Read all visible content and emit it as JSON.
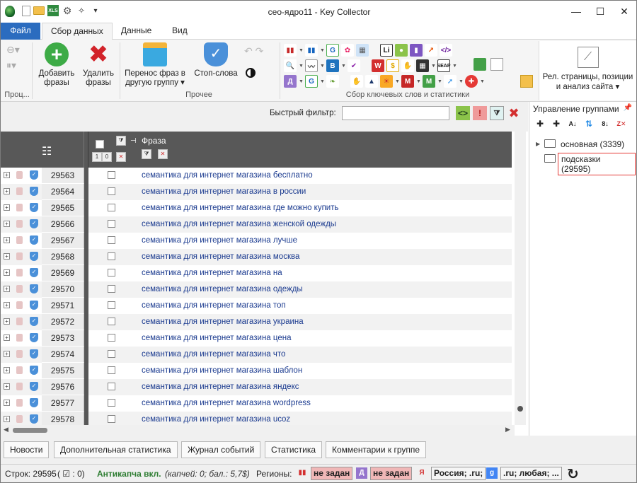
{
  "window": {
    "title": "сео-ядро11 - Key Collector",
    "minimize": "—",
    "maximize": "☐",
    "close": "✕"
  },
  "ribbon_tabs": [
    "Файл",
    "Сбор данных",
    "Данные",
    "Вид"
  ],
  "ribbon": {
    "process_group_label": "Проц...",
    "add_phrases": "Добавить фразы",
    "add_phrases_l1": "Добавить",
    "add_phrases_l2": "фразы",
    "delete_phrases_l1": "Удалить",
    "delete_phrases_l2": "фразы",
    "move_phrases_l1": "Перенос фраз в",
    "move_phrases_l2": "другую группу ▾",
    "stop_words": "Стоп-слова",
    "other_group_label": "Прочее",
    "collect_group_label": "Сбор ключевых слов и статистики",
    "rel_pages_l1": "Рел. страницы, позиции",
    "rel_pages_l2": "и анализ сайта ▾"
  },
  "filter": {
    "label": "Быстрый фильтр:",
    "value": ""
  },
  "grid": {
    "column_phrase": "Фраза",
    "rows": [
      {
        "id": "29563",
        "phrase": "семантика для интернет магазина бесплатно"
      },
      {
        "id": "29564",
        "phrase": "семантика для интернет магазина в россии"
      },
      {
        "id": "29565",
        "phrase": "семантика для интернет магазина где можно купить"
      },
      {
        "id": "29566",
        "phrase": "семантика для интернет магазина женской одежды"
      },
      {
        "id": "29567",
        "phrase": "семантика для интернет магазина лучше"
      },
      {
        "id": "29568",
        "phrase": "семантика для интернет магазина москва"
      },
      {
        "id": "29569",
        "phrase": "семантика для интернет магазина на"
      },
      {
        "id": "29570",
        "phrase": "семантика для интернет магазина одежды"
      },
      {
        "id": "29571",
        "phrase": "семантика для интернет магазина топ"
      },
      {
        "id": "29572",
        "phrase": "семантика для интернет магазина украина"
      },
      {
        "id": "29573",
        "phrase": "семантика для интернет магазина цена"
      },
      {
        "id": "29574",
        "phrase": "семантика для интернет магазина что"
      },
      {
        "id": "29575",
        "phrase": "семантика для интернет магазина шаблон"
      },
      {
        "id": "29576",
        "phrase": "семантика для интернет магазина яндекс"
      },
      {
        "id": "29577",
        "phrase": "семантика для интернет магазина wordpress"
      },
      {
        "id": "29578",
        "phrase": "семантика для интернет магазина ucoz"
      }
    ]
  },
  "group_panel": {
    "title": "Управление группами",
    "groups": [
      {
        "label": "основная (3339)"
      },
      {
        "label": "подсказки (29595)"
      }
    ]
  },
  "bottom_tabs": [
    "Новости",
    "Дополнительная статистика",
    "Журнал событий",
    "Статистика",
    "Комментарии к группе"
  ],
  "status": {
    "rows_label": "Строк: 29595",
    "checked_label": "( ☑ : 0)",
    "anticaptcha": "Антикапча вкл.",
    "anticaptcha_info": "(капчей: 0; бал.: 5,7$)",
    "regions_label": "Регионы:",
    "region1": "не задан",
    "region2": "не задан",
    "region3": "Россия; .ru;",
    "region4": ".ru; любая; ..."
  },
  "colors": {
    "accent": "#2b6cbf",
    "grid_header": "#585858",
    "phrase_text": "#1a3a8f",
    "status_green": "#2e7d32",
    "region_pink": "#f0b7b7"
  }
}
